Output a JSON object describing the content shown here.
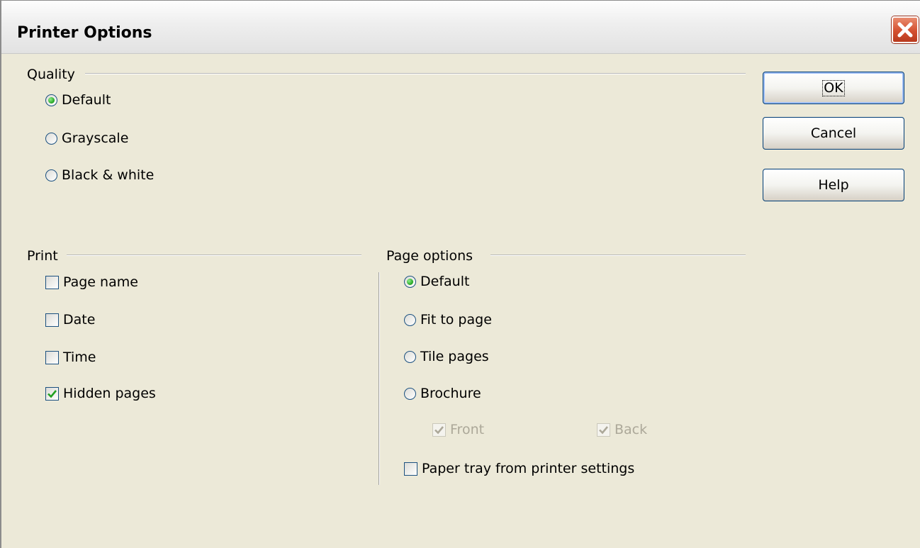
{
  "dialog": {
    "title": "Printer Options"
  },
  "quality": {
    "label": "Quality",
    "options": [
      {
        "label": "Default",
        "checked": true
      },
      {
        "label": "Grayscale",
        "checked": false
      },
      {
        "label": "Black & white",
        "checked": false
      }
    ]
  },
  "print": {
    "label": "Print",
    "options": [
      {
        "label": "Page name",
        "checked": false
      },
      {
        "label": "Date",
        "checked": false
      },
      {
        "label": "Time",
        "checked": false
      },
      {
        "label": "Hidden pages",
        "checked": true
      }
    ]
  },
  "page_options": {
    "label": "Page options",
    "options": [
      {
        "label": "Default",
        "checked": true
      },
      {
        "label": "Fit to page",
        "checked": false
      },
      {
        "label": "Tile pages",
        "checked": false
      },
      {
        "label": "Brochure",
        "checked": false
      }
    ],
    "brochure_sub": [
      {
        "label": "Front",
        "checked": true,
        "disabled": true
      },
      {
        "label": "Back",
        "checked": true,
        "disabled": true
      }
    ],
    "paper_tray": {
      "label": "Paper tray from printer settings",
      "checked": false
    }
  },
  "buttons": {
    "ok": "OK",
    "cancel": "Cancel",
    "help": "Help"
  },
  "colors": {
    "window_bg": "#ece9d8",
    "close_red": "#d45030",
    "radio_checked": "#21a121",
    "button_border": "#003c74"
  },
  "icons": {
    "close": "close-icon",
    "check": "checkmark-icon"
  }
}
